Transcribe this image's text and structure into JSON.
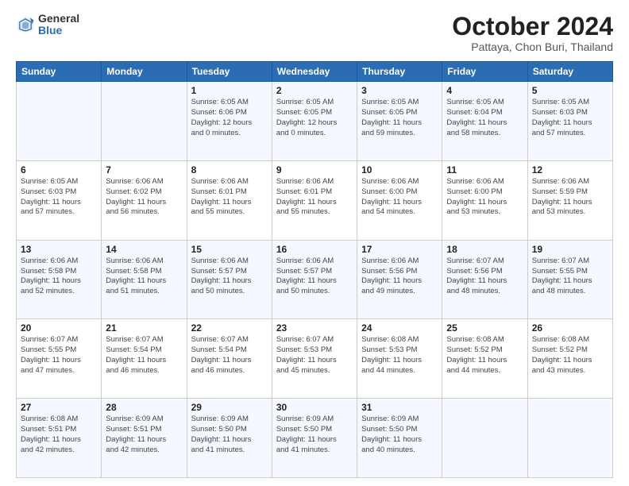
{
  "header": {
    "logo_general": "General",
    "logo_blue": "Blue",
    "title": "October 2024",
    "location": "Pattaya, Chon Buri, Thailand"
  },
  "days_of_week": [
    "Sunday",
    "Monday",
    "Tuesday",
    "Wednesday",
    "Thursday",
    "Friday",
    "Saturday"
  ],
  "weeks": [
    [
      {
        "day": "",
        "info": ""
      },
      {
        "day": "",
        "info": ""
      },
      {
        "day": "1",
        "info": "Sunrise: 6:05 AM\nSunset: 6:06 PM\nDaylight: 12 hours\nand 0 minutes."
      },
      {
        "day": "2",
        "info": "Sunrise: 6:05 AM\nSunset: 6:05 PM\nDaylight: 12 hours\nand 0 minutes."
      },
      {
        "day": "3",
        "info": "Sunrise: 6:05 AM\nSunset: 6:05 PM\nDaylight: 11 hours\nand 59 minutes."
      },
      {
        "day": "4",
        "info": "Sunrise: 6:05 AM\nSunset: 6:04 PM\nDaylight: 11 hours\nand 58 minutes."
      },
      {
        "day": "5",
        "info": "Sunrise: 6:05 AM\nSunset: 6:03 PM\nDaylight: 11 hours\nand 57 minutes."
      }
    ],
    [
      {
        "day": "6",
        "info": "Sunrise: 6:05 AM\nSunset: 6:03 PM\nDaylight: 11 hours\nand 57 minutes."
      },
      {
        "day": "7",
        "info": "Sunrise: 6:06 AM\nSunset: 6:02 PM\nDaylight: 11 hours\nand 56 minutes."
      },
      {
        "day": "8",
        "info": "Sunrise: 6:06 AM\nSunset: 6:01 PM\nDaylight: 11 hours\nand 55 minutes."
      },
      {
        "day": "9",
        "info": "Sunrise: 6:06 AM\nSunset: 6:01 PM\nDaylight: 11 hours\nand 55 minutes."
      },
      {
        "day": "10",
        "info": "Sunrise: 6:06 AM\nSunset: 6:00 PM\nDaylight: 11 hours\nand 54 minutes."
      },
      {
        "day": "11",
        "info": "Sunrise: 6:06 AM\nSunset: 6:00 PM\nDaylight: 11 hours\nand 53 minutes."
      },
      {
        "day": "12",
        "info": "Sunrise: 6:06 AM\nSunset: 5:59 PM\nDaylight: 11 hours\nand 53 minutes."
      }
    ],
    [
      {
        "day": "13",
        "info": "Sunrise: 6:06 AM\nSunset: 5:58 PM\nDaylight: 11 hours\nand 52 minutes."
      },
      {
        "day": "14",
        "info": "Sunrise: 6:06 AM\nSunset: 5:58 PM\nDaylight: 11 hours\nand 51 minutes."
      },
      {
        "day": "15",
        "info": "Sunrise: 6:06 AM\nSunset: 5:57 PM\nDaylight: 11 hours\nand 50 minutes."
      },
      {
        "day": "16",
        "info": "Sunrise: 6:06 AM\nSunset: 5:57 PM\nDaylight: 11 hours\nand 50 minutes."
      },
      {
        "day": "17",
        "info": "Sunrise: 6:06 AM\nSunset: 5:56 PM\nDaylight: 11 hours\nand 49 minutes."
      },
      {
        "day": "18",
        "info": "Sunrise: 6:07 AM\nSunset: 5:56 PM\nDaylight: 11 hours\nand 48 minutes."
      },
      {
        "day": "19",
        "info": "Sunrise: 6:07 AM\nSunset: 5:55 PM\nDaylight: 11 hours\nand 48 minutes."
      }
    ],
    [
      {
        "day": "20",
        "info": "Sunrise: 6:07 AM\nSunset: 5:55 PM\nDaylight: 11 hours\nand 47 minutes."
      },
      {
        "day": "21",
        "info": "Sunrise: 6:07 AM\nSunset: 5:54 PM\nDaylight: 11 hours\nand 46 minutes."
      },
      {
        "day": "22",
        "info": "Sunrise: 6:07 AM\nSunset: 5:54 PM\nDaylight: 11 hours\nand 46 minutes."
      },
      {
        "day": "23",
        "info": "Sunrise: 6:07 AM\nSunset: 5:53 PM\nDaylight: 11 hours\nand 45 minutes."
      },
      {
        "day": "24",
        "info": "Sunrise: 6:08 AM\nSunset: 5:53 PM\nDaylight: 11 hours\nand 44 minutes."
      },
      {
        "day": "25",
        "info": "Sunrise: 6:08 AM\nSunset: 5:52 PM\nDaylight: 11 hours\nand 44 minutes."
      },
      {
        "day": "26",
        "info": "Sunrise: 6:08 AM\nSunset: 5:52 PM\nDaylight: 11 hours\nand 43 minutes."
      }
    ],
    [
      {
        "day": "27",
        "info": "Sunrise: 6:08 AM\nSunset: 5:51 PM\nDaylight: 11 hours\nand 42 minutes."
      },
      {
        "day": "28",
        "info": "Sunrise: 6:09 AM\nSunset: 5:51 PM\nDaylight: 11 hours\nand 42 minutes."
      },
      {
        "day": "29",
        "info": "Sunrise: 6:09 AM\nSunset: 5:50 PM\nDaylight: 11 hours\nand 41 minutes."
      },
      {
        "day": "30",
        "info": "Sunrise: 6:09 AM\nSunset: 5:50 PM\nDaylight: 11 hours\nand 41 minutes."
      },
      {
        "day": "31",
        "info": "Sunrise: 6:09 AM\nSunset: 5:50 PM\nDaylight: 11 hours\nand 40 minutes."
      },
      {
        "day": "",
        "info": ""
      },
      {
        "day": "",
        "info": ""
      }
    ]
  ]
}
